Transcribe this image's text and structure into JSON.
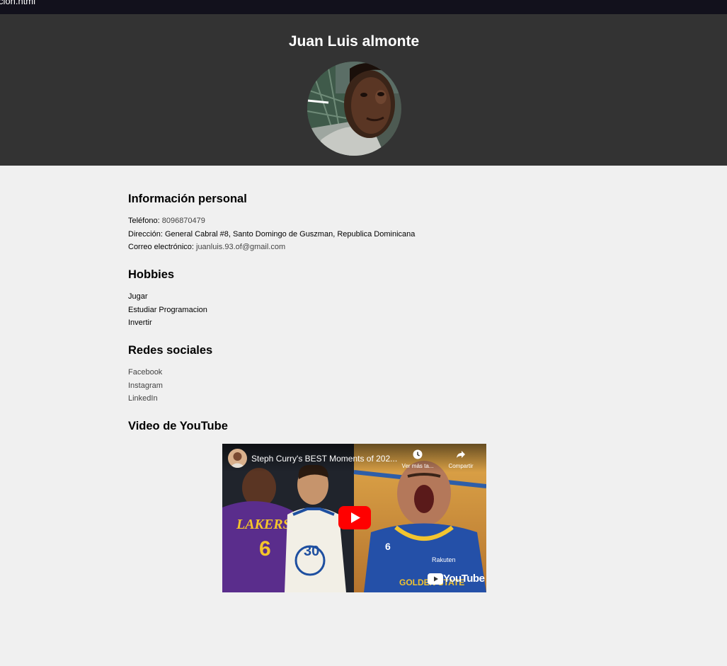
{
  "browser": {
    "tab_text": "cion.html"
  },
  "header": {
    "name": "Juan Luis almonte"
  },
  "info": {
    "title": "Información personal",
    "phone_label": "Teléfono:",
    "phone_value": "8096870479",
    "address_label": "Dirección:",
    "address_value": "General Cabral #8, Santo Domingo de Guszman, Republica Dominicana",
    "email_label": "Correo electrónico:",
    "email_value": "juanluis.93.of@gmail.com"
  },
  "hobbies": {
    "title": "Hobbies",
    "items": [
      "Jugar",
      "Estudiar Programacion",
      "Invertir"
    ]
  },
  "social": {
    "title": "Redes sociales",
    "items": [
      "Facebook",
      "Instagram",
      "LinkedIn"
    ]
  },
  "video": {
    "title": "Video de YouTube",
    "video_title": "Steph Curry's BEST Moments of 202...",
    "watch_later": "Ver más ta...",
    "share": "Compartir",
    "brand": "YouTube"
  },
  "colors": {
    "header_bg": "#333333",
    "page_bg": "#f0f0f0",
    "youtube_red": "#ff0000"
  }
}
